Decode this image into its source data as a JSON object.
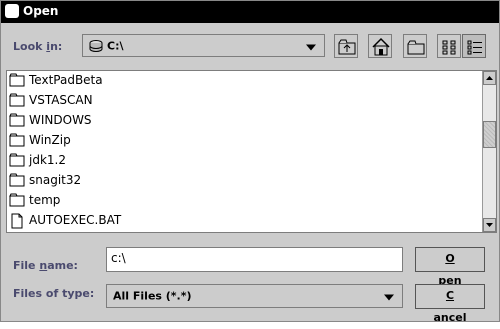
{
  "window": {
    "title": "Open"
  },
  "look_in": {
    "label": "Look in:",
    "value": "C:\\"
  },
  "toolbar": {
    "up_icon": "up-one-level-icon",
    "home_icon": "home-icon",
    "new_folder_icon": "new-folder-icon",
    "list_icon": "list-view-icon",
    "details_icon": "details-view-icon"
  },
  "files": {
    "items": [
      {
        "name": "TextPadBeta",
        "type": "folder"
      },
      {
        "name": "VSTASCAN",
        "type": "folder"
      },
      {
        "name": "WINDOWS",
        "type": "folder"
      },
      {
        "name": "WinZip",
        "type": "folder"
      },
      {
        "name": "jdk1.2",
        "type": "folder"
      },
      {
        "name": "snagit32",
        "type": "folder"
      },
      {
        "name": "temp",
        "type": "folder"
      },
      {
        "name": "AUTOEXEC.BAT",
        "type": "file"
      }
    ]
  },
  "file_name": {
    "label": "File name:",
    "value": "c:\\"
  },
  "file_type": {
    "label": "Files of type:",
    "value": "All Files (*.*)"
  },
  "buttons": {
    "open": "Open",
    "cancel": "Cancel"
  },
  "colors": {
    "window_bg": "#cccccc",
    "label_text": "#4a4a6e",
    "title_bg": "#000000"
  }
}
